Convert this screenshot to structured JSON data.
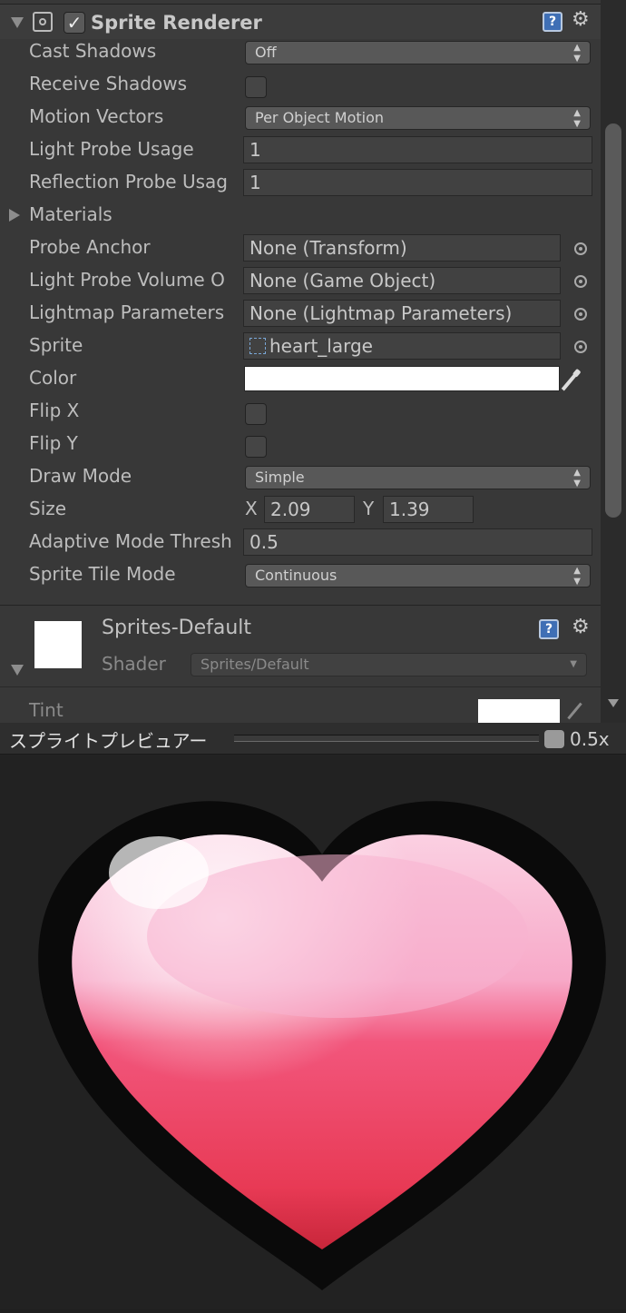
{
  "component": {
    "title": "Sprite Renderer",
    "enabled": true,
    "help_icon": "help-icon",
    "settings_icon": "gear-icon"
  },
  "properties": {
    "cast_shadows": {
      "label": "Cast Shadows",
      "value": "Off"
    },
    "receive_shadows": {
      "label": "Receive Shadows",
      "checked": false
    },
    "motion_vectors": {
      "label": "Motion Vectors",
      "value": "Per Object Motion"
    },
    "light_probe_usage": {
      "label": "Light Probe Usage",
      "value": "1"
    },
    "reflection_probe_usage": {
      "label": "Reflection Probe Usag",
      "value": "1"
    },
    "materials": {
      "label": "Materials"
    },
    "probe_anchor": {
      "label": "Probe Anchor",
      "value": "None (Transform)"
    },
    "light_probe_volume": {
      "label": "Light Probe Volume O",
      "value": "None (Game Object)"
    },
    "lightmap_parameters": {
      "label": "Lightmap Parameters",
      "value": "None (Lightmap Parameters)"
    },
    "sprite": {
      "label": "Sprite",
      "value": "heart_large"
    },
    "color": {
      "label": "Color",
      "value": "#ffffff"
    },
    "flip_x": {
      "label": "Flip X",
      "checked": false
    },
    "flip_y": {
      "label": "Flip Y",
      "checked": false
    },
    "draw_mode": {
      "label": "Draw Mode",
      "value": "Simple"
    },
    "size": {
      "label": "Size",
      "x_label": "X",
      "x": "2.09",
      "y_label": "Y",
      "y": "1.39"
    },
    "adaptive_mode_threshold": {
      "label": "Adaptive Mode Thresh",
      "value": "0.5"
    },
    "sprite_tile_mode": {
      "label": "Sprite Tile Mode",
      "value": "Continuous"
    }
  },
  "material": {
    "name": "Sprites-Default",
    "shader_label": "Shader",
    "shader_value": "Sprites/Default",
    "tint_label": "Tint",
    "tint_color": "#ffffff"
  },
  "preview": {
    "title": "スプライトプレビュアー",
    "zoom": "0.5x"
  },
  "colors": {
    "panel_bg": "#383838",
    "preview_bg": "#222222",
    "heart_pink": "#f03c64",
    "heart_light": "#f8a8c8"
  }
}
